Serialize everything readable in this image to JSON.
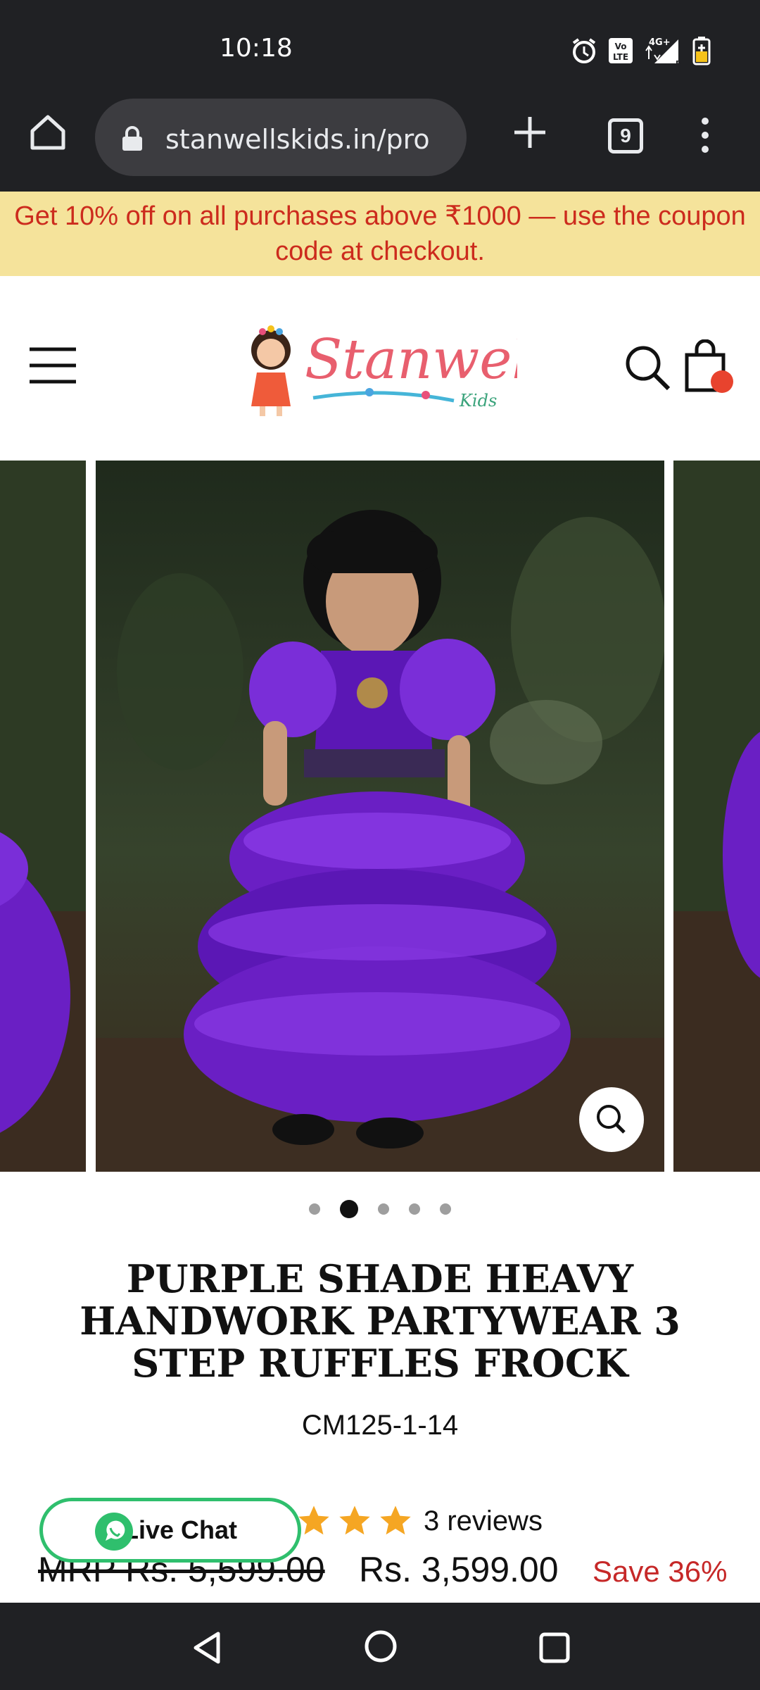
{
  "status_bar": {
    "time": "10:18",
    "icons": [
      "alarm-icon",
      "volte-icon",
      "4g-signal-icon",
      "battery-icon"
    ],
    "network_label": "4G+"
  },
  "browser": {
    "url": "stanwellskids.in/pro",
    "tab_count": "9"
  },
  "promo": {
    "text": "Get 10% off on all purchases above ₹1000 — use the coupon code at checkout."
  },
  "header": {
    "logo_text": "Stanwells",
    "logo_subtext": "Kids",
    "cart_badge_color": "#e8432e"
  },
  "gallery": {
    "slide_count": 5,
    "active_slide": 2
  },
  "product": {
    "title": "PURPLE SHADE HEAVY HANDWORK PARTYWEAR 3 STEP RUFFLES FROCK",
    "sku": "CM125-1-14",
    "rating_stars": 5,
    "reviews": "3 reviews",
    "mrp": "MRP Rs. 5,599.00",
    "price": "Rs. 3,599.00",
    "save": "Save 36%"
  },
  "live_chat": {
    "label": "Live Chat",
    "color": "#2fbf6d"
  },
  "colors": {
    "accent_red": "#c62828",
    "promo_bg": "#f5e39b",
    "dress_purple": "#6a1fc4",
    "star": "#f5a623"
  }
}
